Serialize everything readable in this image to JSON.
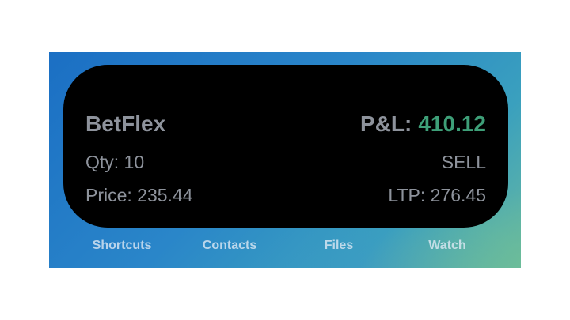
{
  "widget": {
    "name": "BetFlex",
    "pnl_label": "P&L:",
    "pnl_value": "410.12",
    "qty": "Qty: 10",
    "side": "SELL",
    "price": "Price: 235.44",
    "ltp": "LTP: 276.45"
  },
  "dock": {
    "items": [
      {
        "label": "Shortcuts"
      },
      {
        "label": "Contacts"
      },
      {
        "label": "Files"
      },
      {
        "label": "Watch"
      }
    ]
  },
  "colors": {
    "pnl_positive": "#3e9f78",
    "widget_text": "#8e939c",
    "widget_bg": "#000000"
  }
}
